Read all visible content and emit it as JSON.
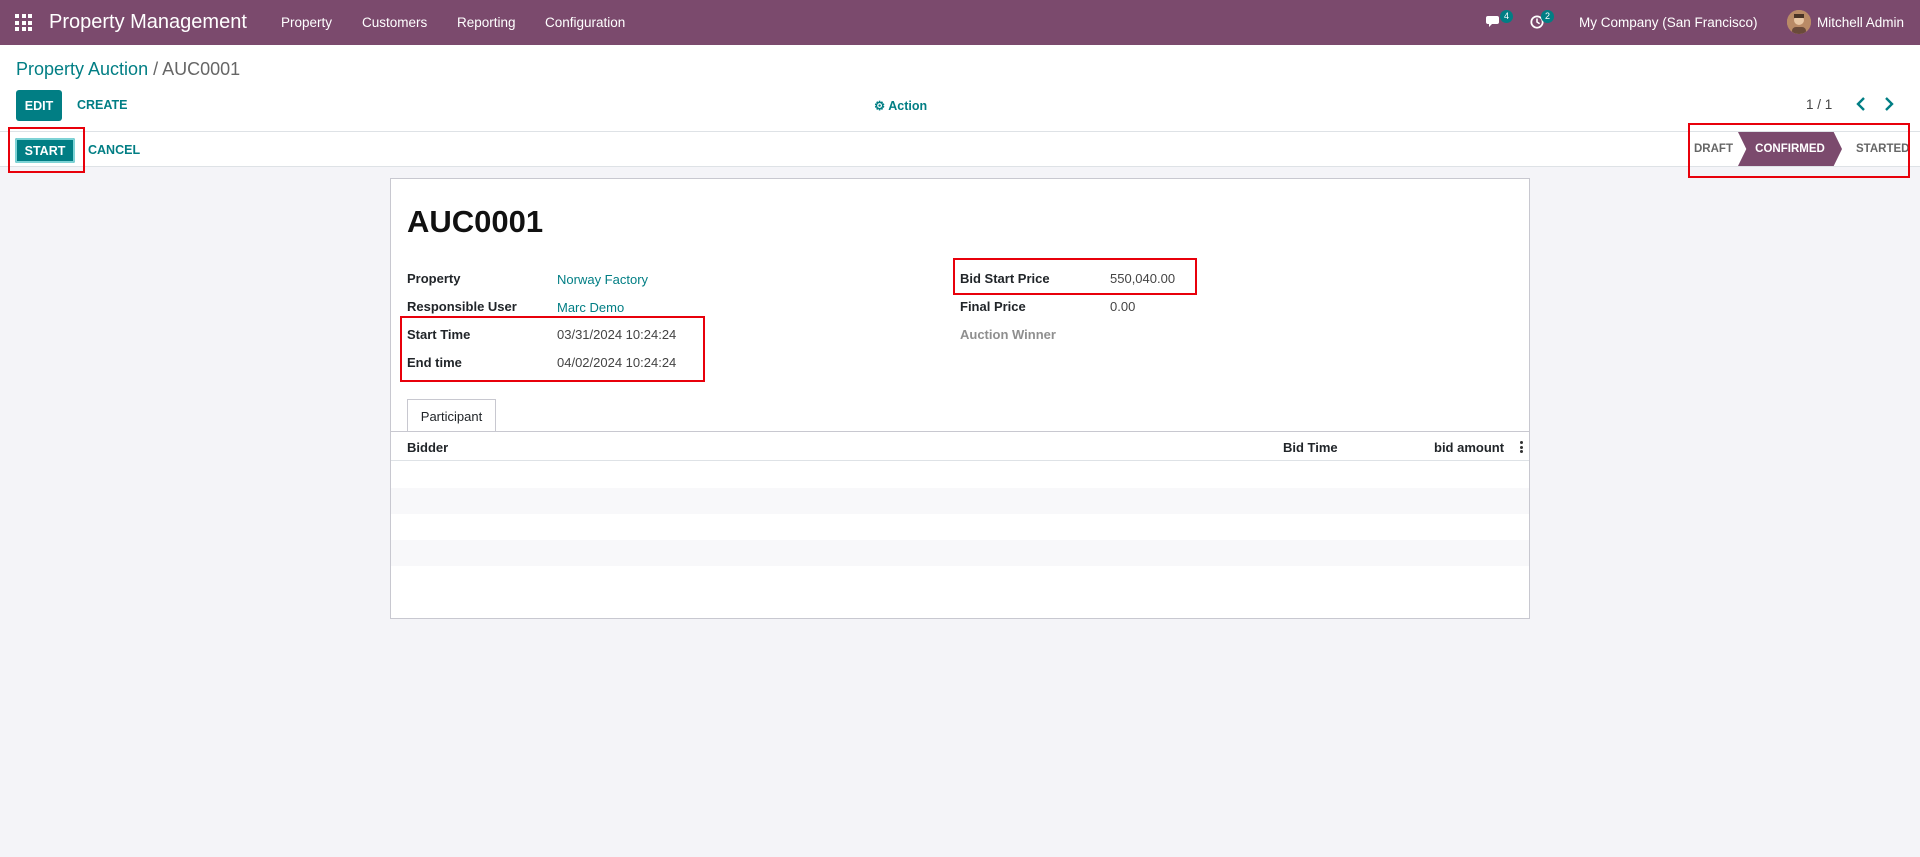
{
  "navbar": {
    "brand": "Property Management",
    "menu": [
      "Property",
      "Customers",
      "Reporting",
      "Configuration"
    ],
    "messages_count": "4",
    "activities_count": "2",
    "company": "My Company (San Francisco)",
    "user": "Mitchell Admin"
  },
  "breadcrumb": {
    "parent": "Property Auction",
    "separator": "/",
    "current": "AUC0001"
  },
  "control": {
    "edit_label": "EDIT",
    "create_label": "CREATE",
    "action_label": "Action",
    "pager": "1 / 1"
  },
  "statusbar": {
    "start_label": "START",
    "cancel_label": "CANCEL",
    "stages": [
      "DRAFT",
      "CONFIRMED",
      "STARTED"
    ],
    "active_stage": "CONFIRMED"
  },
  "form": {
    "name": "AUC0001",
    "left_fields": [
      {
        "label": "Property",
        "value": "Norway Factory"
      },
      {
        "label": "Responsible User",
        "value": "Marc Demo"
      },
      {
        "label": "Start Time",
        "value": "03/31/2024 10:24:24"
      },
      {
        "label": "End time",
        "value": "04/02/2024 10:24:24"
      }
    ],
    "right_fields": [
      {
        "label": "Bid Start Price",
        "value": "550,040.00"
      },
      {
        "label": "Final Price",
        "value": "0.00"
      },
      {
        "label": "Auction Winner",
        "value": ""
      }
    ],
    "tab": "Participant",
    "columns": [
      "Bidder",
      "Bid Time",
      "bid amount"
    ]
  },
  "colors": {
    "primary": "#017e84",
    "navbar": "#7b4a6d",
    "highlight": "#e8000b"
  }
}
